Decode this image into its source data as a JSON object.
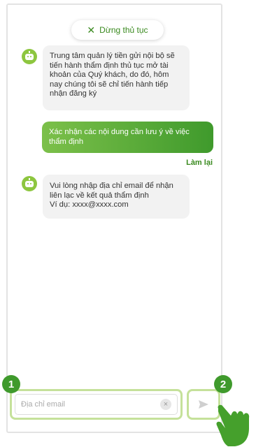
{
  "header": {
    "stop_label": "Dừng thủ tục"
  },
  "messages": {
    "bot1": "Trung tâm quản lý tiền gửi nội bộ sẽ tiến hành thẩm định thủ tục mở tài khoản của Quý khách, do đó, hôm nay chúng tôi sẽ chỉ tiến hành tiếp nhận đăng ký",
    "user1": "Xác nhận các nội dung cần lưu ý về việc thẩm định",
    "redo_label": "Làm lại",
    "bot2_line1": "Vui lòng nhập địa chỉ email để nhận",
    "bot2_line2": "liên lạc về kết quả thẩm định",
    "bot2_line3": "Ví dụ: xxxx@xxxx.com"
  },
  "input": {
    "placeholder": "Địa chỉ email",
    "clear_icon": "×"
  },
  "callouts": {
    "one": "1",
    "two": "2"
  },
  "colors": {
    "accent": "#3f9a2c",
    "highlight": "#c5e19a",
    "bot": "#8dc63f"
  }
}
